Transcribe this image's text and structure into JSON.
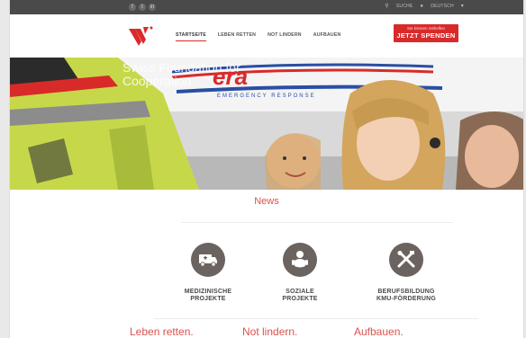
{
  "topbar": {
    "social_icons": [
      "facebook-icon",
      "twitter-icon",
      "linkedin-icon"
    ],
    "search_label": "SUCHE",
    "language_label": "DEUTSCH"
  },
  "header": {
    "nav": [
      {
        "label": "STARTSEITE",
        "active": true
      },
      {
        "label": "LEBEN RETTEN",
        "active": false
      },
      {
        "label": "NOT LINDERN",
        "active": false
      },
      {
        "label": "AUFBAUEN",
        "active": false
      }
    ],
    "donate_small": "Sie können mithelfen",
    "donate_big": "JETZT SPENDEN"
  },
  "hero": {
    "text": "Swiss Foundation for Cooperation"
  },
  "main": {
    "news_title": "News",
    "cards": [
      {
        "icon": "ambulance-icon",
        "line1": "MEDIZINISCHE",
        "line2": "PROJEKTE"
      },
      {
        "icon": "baby-icon",
        "line1": "SOZIALE",
        "line2": "PROJEKTE"
      },
      {
        "icon": "tools-icon",
        "line1": "BERUFSBILDUNG",
        "line2": "KMU-FÖRDERUNG"
      }
    ],
    "slogans": [
      "Leben retten.",
      "Not lindern.",
      "Aufbauen."
    ]
  },
  "colors": {
    "accent": "#d92a2a",
    "topbar": "#4a4a4a",
    "icon_circle": "#6b6360"
  }
}
